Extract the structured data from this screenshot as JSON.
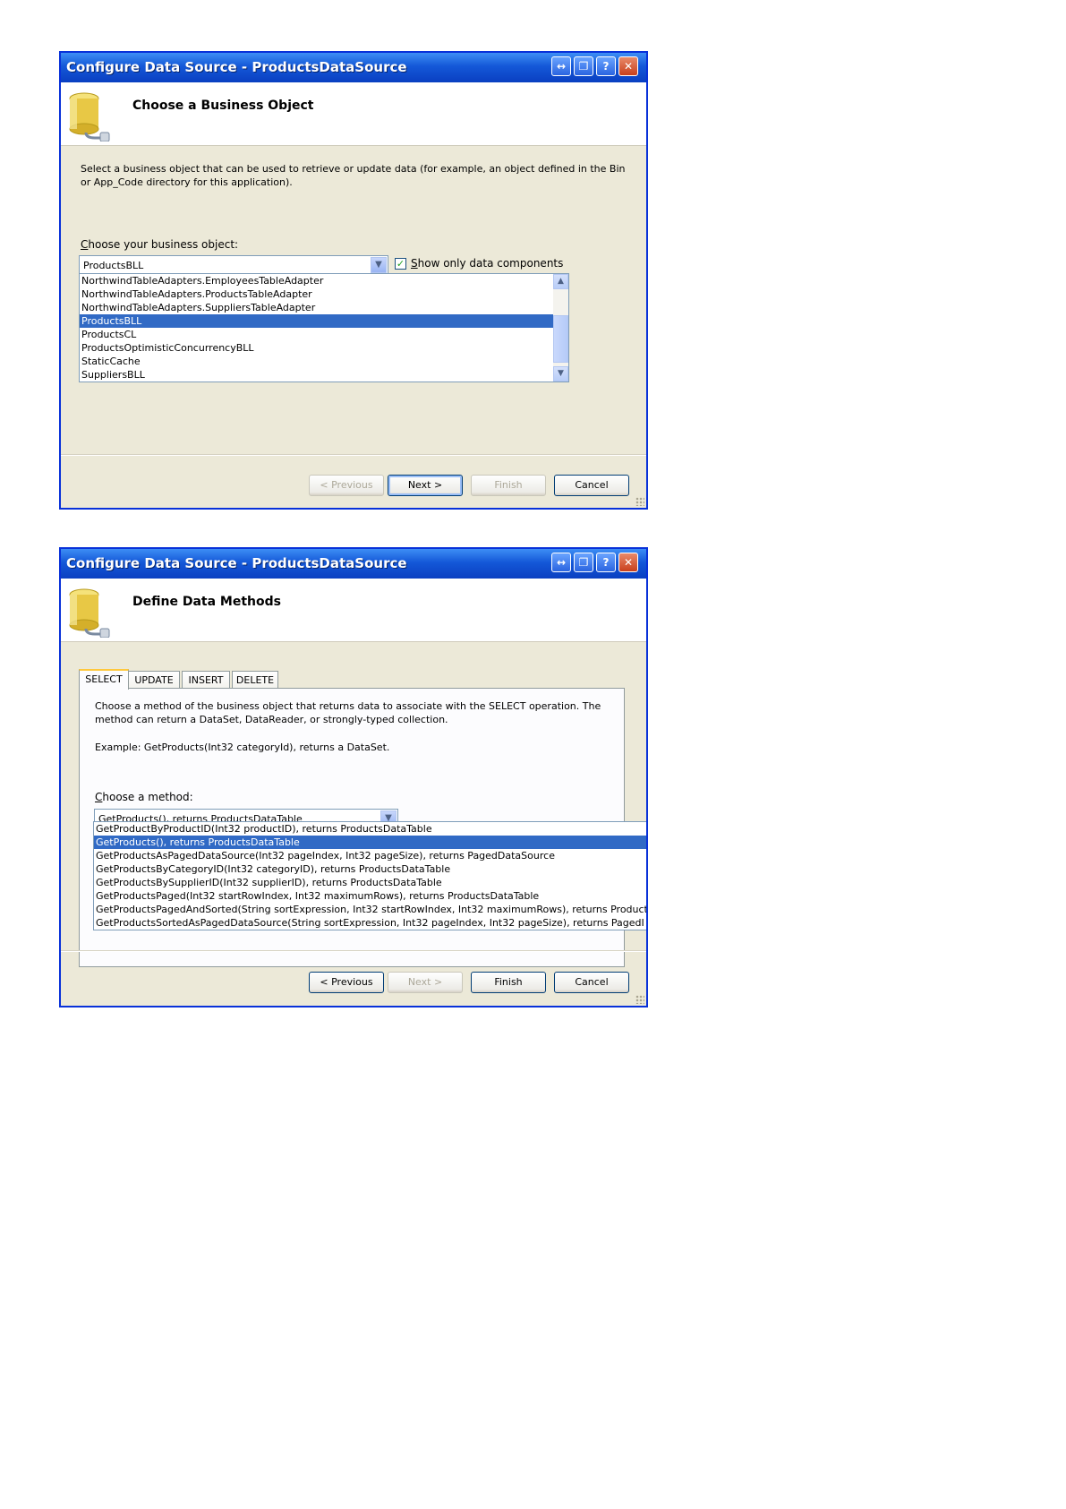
{
  "dialog1": {
    "title": "Configure Data Source - ProductsDataSource",
    "header_title": "Choose a Business Object",
    "description": "Select a business object that can be used to retrieve or update data (for example, an object defined in the Bin or App_Code directory for this application).",
    "label_key": "C",
    "label_rest": "hoose your business object:",
    "combo_value": "ProductsBLL",
    "checkbox_checked": true,
    "checkbox_label_key": "S",
    "checkbox_label_rest": "how only data components",
    "items": [
      "NorthwindTableAdapters.EmployeesTableAdapter",
      "NorthwindTableAdapters.ProductsTableAdapter",
      "NorthwindTableAdapters.SuppliersTableAdapter",
      "ProductsBLL",
      "ProductsCL",
      "ProductsOptimisticConcurrencyBLL",
      "StaticCache",
      "SuppliersBLL"
    ],
    "selected_index": 3,
    "buttons": {
      "previous": "< Previous",
      "next": "Next >",
      "finish": "Finish",
      "cancel": "Cancel"
    }
  },
  "dialog2": {
    "title": "Configure Data Source - ProductsDataSource",
    "header_title": "Define Data Methods",
    "tabs": [
      "SELECT",
      "UPDATE",
      "INSERT",
      "DELETE"
    ],
    "active_tab": 0,
    "description": "Choose a method of the business object that returns data to associate with the SELECT operation. The method can return a DataSet, DataReader, or strongly-typed collection.",
    "example": "Example: GetProducts(Int32 categoryId), returns a DataSet.",
    "label_key": "C",
    "label_rest": "hoose a method:",
    "combo_value": "GetProducts(), returns ProductsDataTable",
    "items": [
      "GetProductByProductID(Int32 productID), returns ProductsDataTable",
      "GetProducts(), returns ProductsDataTable",
      "GetProductsAsPagedDataSource(Int32 pageIndex, Int32 pageSize), returns PagedDataSource",
      "GetProductsByCategoryID(Int32 categoryID), returns ProductsDataTable",
      "GetProductsBySupplierID(Int32 supplierID), returns ProductsDataTable",
      "GetProductsPaged(Int32 startRowIndex, Int32 maximumRows), returns ProductsDataTable",
      "GetProductsPagedAndSorted(String sortExpression, Int32 startRowIndex, Int32 maximumRows), returns Product",
      "GetProductsSortedAsPagedDataSource(String sortExpression, Int32 pageIndex, Int32 pageSize), returns PagedI"
    ],
    "selected_index": 1,
    "buttons": {
      "previous": "< Previous",
      "next": "Next >",
      "finish": "Finish",
      "cancel": "Cancel"
    }
  },
  "colors": {
    "titlebar": "#0a3fc1",
    "dialog_bg": "#ece9d8",
    "selection": "#316ac5",
    "tab_highlight": "#ffc83c"
  },
  "icons": [
    "database-plug-icon",
    "context-help-button-icon",
    "minimize-icon",
    "help-icon",
    "close-icon",
    "dropdown-arrow-icon",
    "checkmark-icon"
  ]
}
